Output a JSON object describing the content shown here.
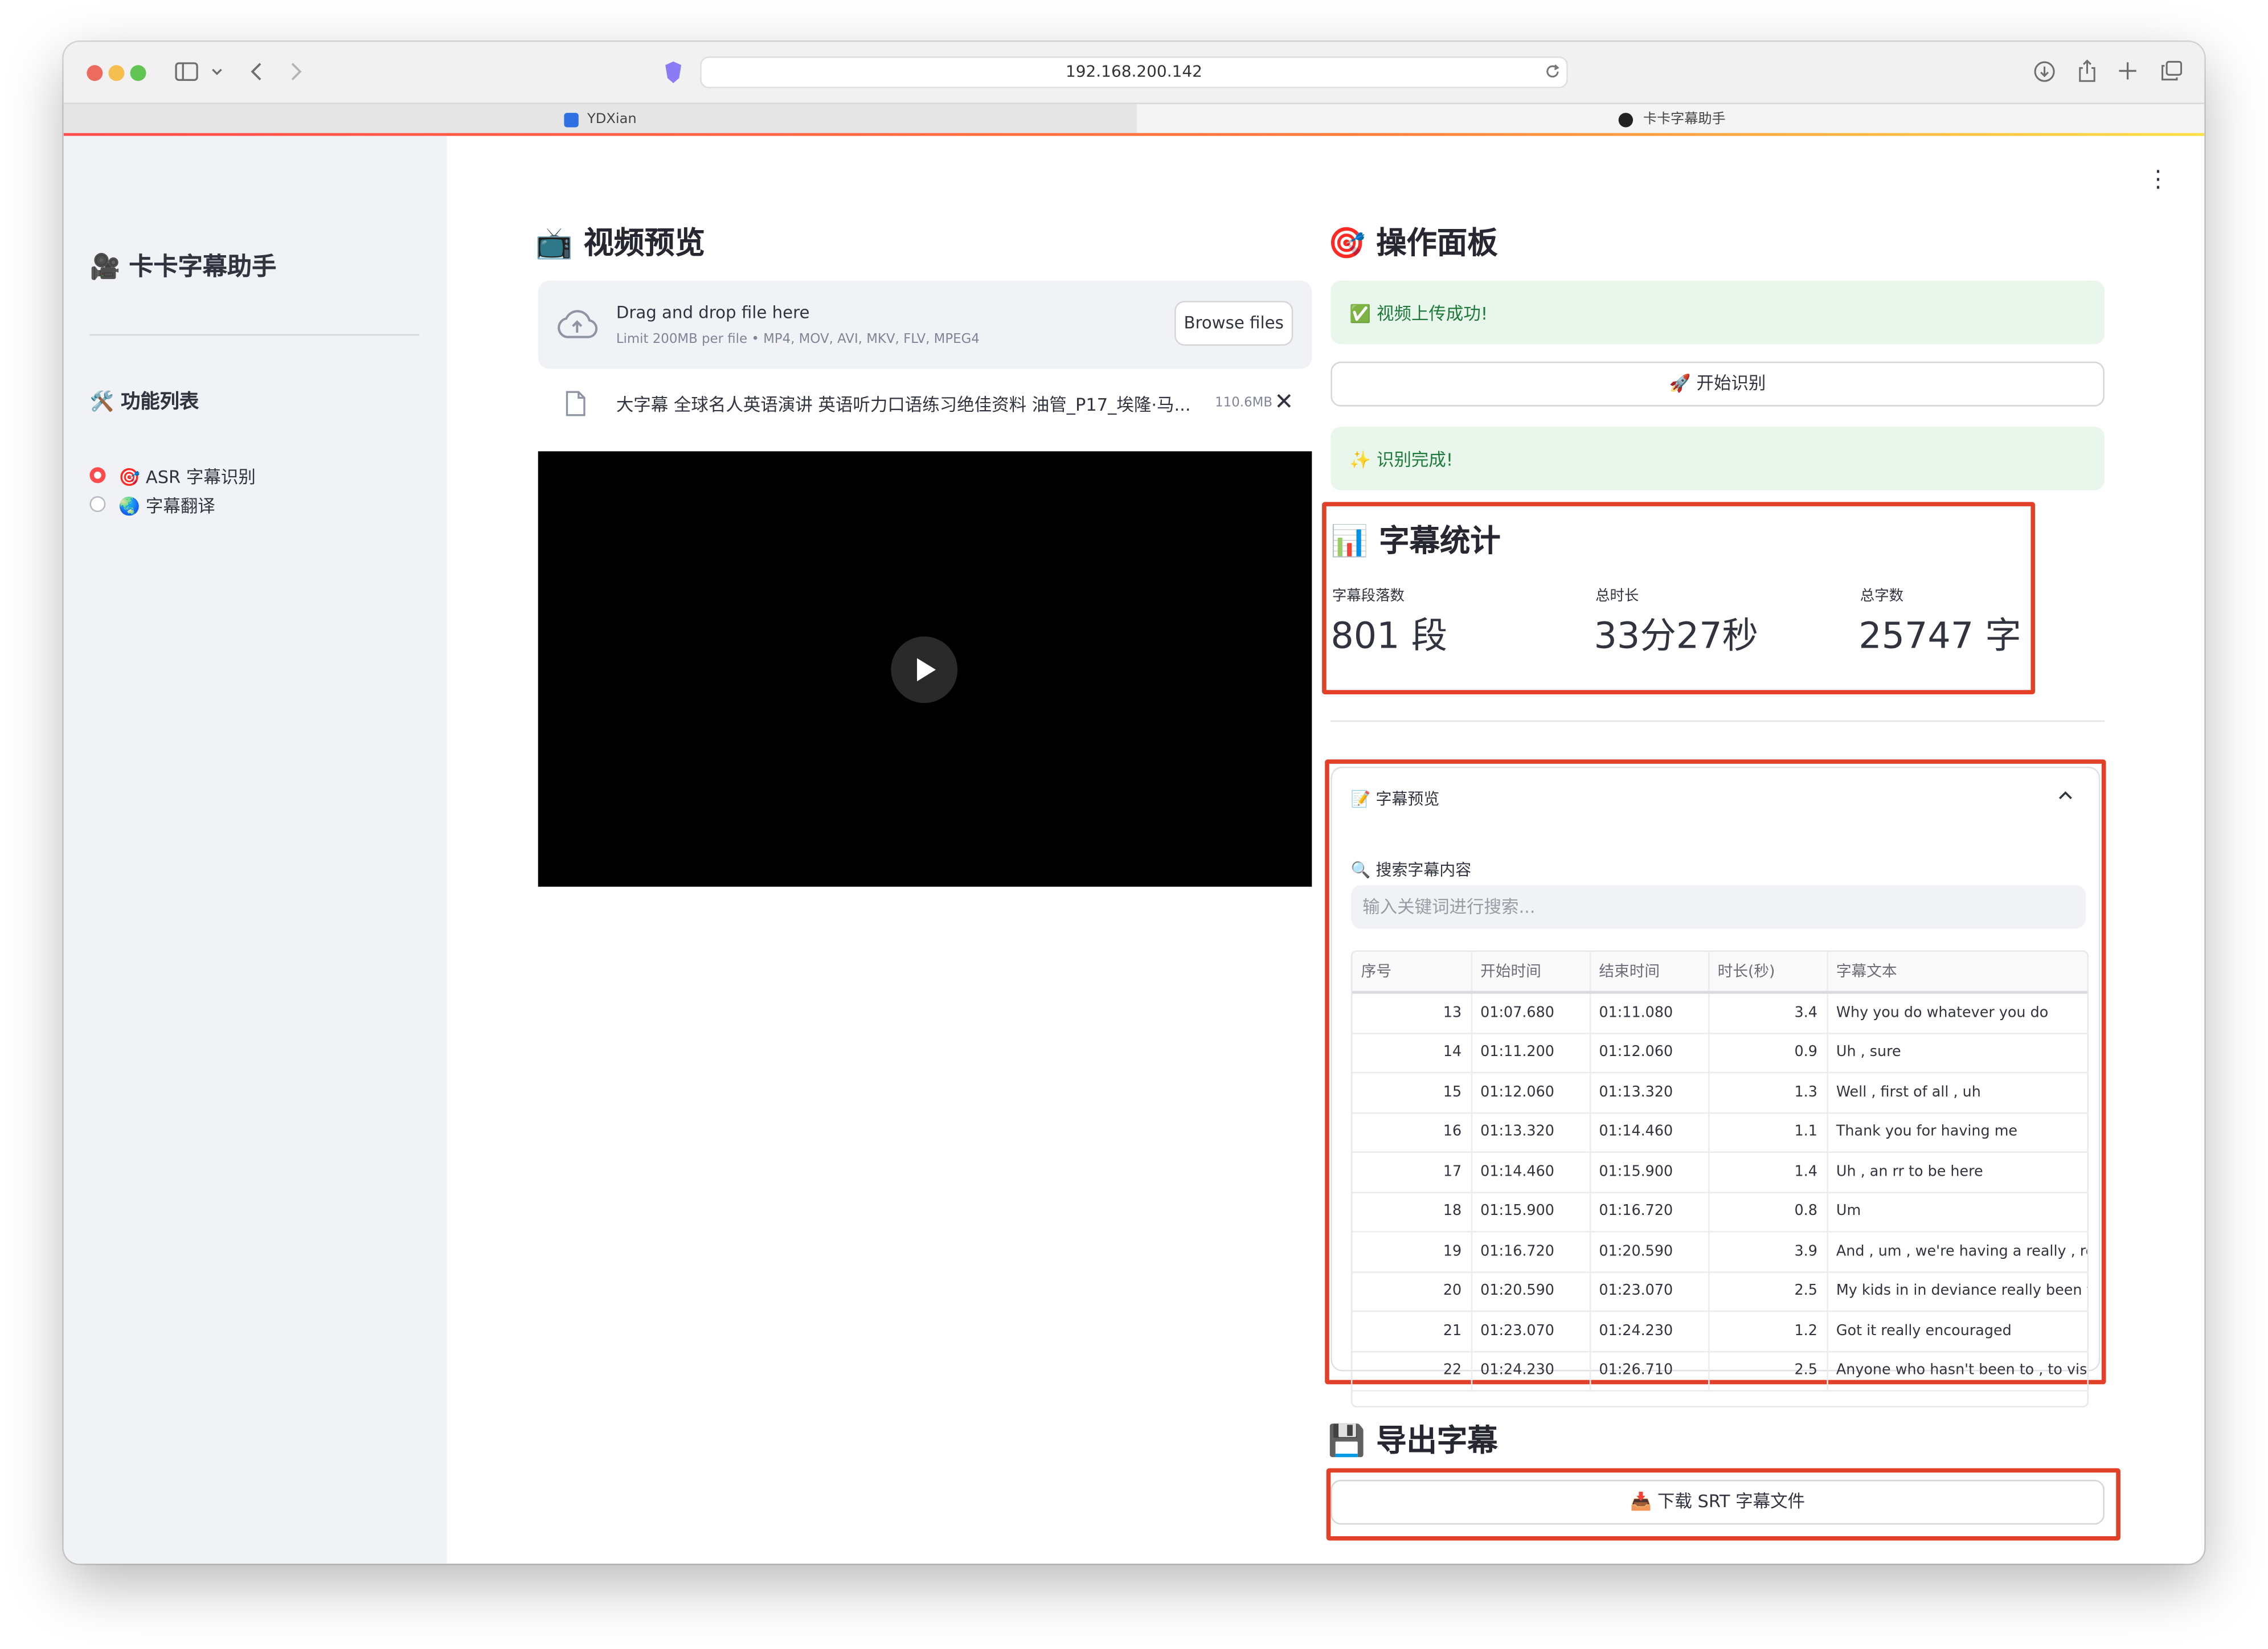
{
  "browser": {
    "url": "192.168.200.142",
    "tabs": [
      {
        "label": "YDXian",
        "active": false
      },
      {
        "label": "卡卡字幕助手",
        "active": true
      }
    ]
  },
  "sidebar": {
    "title": "🎥 卡卡字幕助手",
    "section_title": "🛠️ 功能列表",
    "radio_options": [
      {
        "label": "🎯 ASR 字幕识别",
        "selected": true
      },
      {
        "label": "🌏 字幕翻译",
        "selected": false
      }
    ]
  },
  "video_section": {
    "title": "📺 视频预览",
    "uploader": {
      "drag_text": "Drag and drop file here",
      "limit_text": "Limit 200MB per file • MP4, MOV, AVI, MKV, FLV, MPEG4",
      "browse_label": "Browse files"
    },
    "file": {
      "name": "大字幕 全球名人英语演讲 英语听力口语练习绝佳资料 油管_P17_埃隆·马...",
      "size": "110.6MB"
    }
  },
  "panel": {
    "title": "🎯 操作面板",
    "upload_success": "✅ 视频上传成功!",
    "start_button": "🚀 开始识别",
    "recognize_done": "✨ 识别完成!"
  },
  "stats": {
    "title": "📊 字幕统计",
    "metrics": [
      {
        "label": "字幕段落数",
        "value": "801 段"
      },
      {
        "label": "总时长",
        "value": "33分27秒"
      },
      {
        "label": "总字数",
        "value": "25747 字"
      }
    ]
  },
  "preview": {
    "title": "📝 字幕预览",
    "search_label": "🔍 搜索字幕内容",
    "search_placeholder": "输入关键词进行搜索...",
    "columns": [
      "序号",
      "开始时间",
      "结束时间",
      "时长(秒)",
      "字幕文本"
    ],
    "rows": [
      [
        "13",
        "01:07.680",
        "01:11.080",
        "3.4",
        "Why you do whatever you do"
      ],
      [
        "14",
        "01:11.200",
        "01:12.060",
        "0.9",
        "Uh , sure"
      ],
      [
        "15",
        "01:12.060",
        "01:13.320",
        "1.3",
        "Well , first of all , uh"
      ],
      [
        "16",
        "01:13.320",
        "01:14.460",
        "1.1",
        "Thank you for having me"
      ],
      [
        "17",
        "01:14.460",
        "01:15.900",
        "1.4",
        "Uh , an rr to be here"
      ],
      [
        "18",
        "01:15.900",
        "01:16.720",
        "0.8",
        "Um"
      ],
      [
        "19",
        "01:16.720",
        "01:20.590",
        "3.9",
        "And , um , we're having a really , really"
      ],
      [
        "20",
        "01:20.590",
        "01:23.070",
        "2.5",
        "My kids in in deviance really been fant"
      ],
      [
        "21",
        "01:23.070",
        "01:24.230",
        "1.2",
        "Got it really encouraged"
      ],
      [
        "22",
        "01:24.230",
        "01:26.710",
        "2.5",
        "Anyone who hasn't been to , to visit , u"
      ]
    ]
  },
  "export": {
    "title": "💾 导出字幕",
    "download_button": "📥 下载 SRT 字幕文件"
  },
  "colors": {
    "accent_red": "#ff4b4b",
    "annotation_red": "#e3402a",
    "success_bg": "#e9f6ec",
    "success_text": "#1d7a3a",
    "sidebar_bg": "#f0f2f6"
  }
}
